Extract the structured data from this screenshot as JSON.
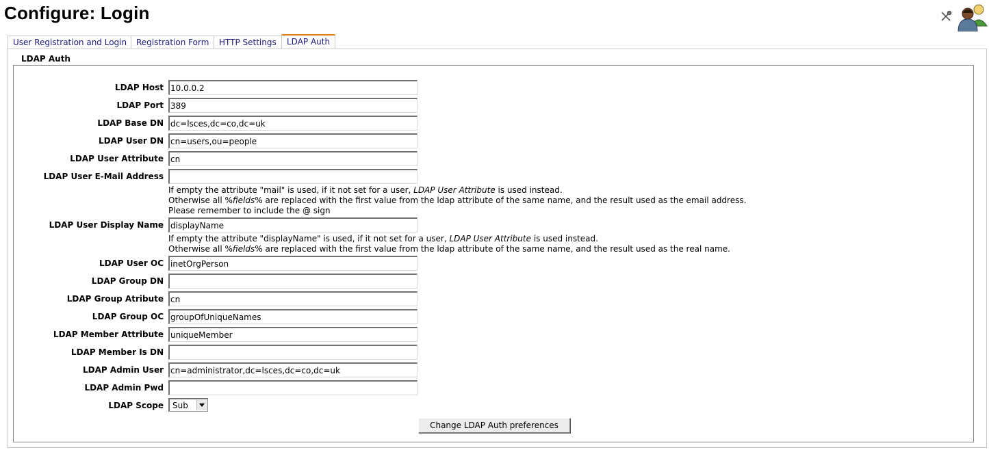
{
  "page": {
    "title": "Configure: Login"
  },
  "tabs": [
    {
      "label": "User Registration and Login"
    },
    {
      "label": "Registration Form"
    },
    {
      "label": "HTTP Settings"
    },
    {
      "label": "LDAP Auth"
    }
  ],
  "form": {
    "legend": "LDAP Auth",
    "fields": [
      {
        "label": "LDAP Host",
        "value": "10.0.0.2"
      },
      {
        "label": "LDAP Port",
        "value": "389"
      },
      {
        "label": "LDAP Base DN",
        "value": "dc=lsces,dc=co,dc=uk"
      },
      {
        "label": "LDAP User DN",
        "value": "cn=users,ou=people"
      },
      {
        "label": "LDAP User Attribute",
        "value": "cn"
      },
      {
        "label": "LDAP User E-Mail Address",
        "value": "",
        "help": [
          {
            "pre": "If empty the attribute \"mail\" is used, if it not set for a user, ",
            "em": "LDAP User Attribute",
            "post": " is used instead."
          },
          {
            "pre": "Otherwise all %",
            "em": "fields",
            "post": "% are replaced with the first value from the ldap attribute of the same name, and the result used as the email address."
          },
          {
            "pre": "Please remember to include the @ sign",
            "em": "",
            "post": ""
          }
        ]
      },
      {
        "label": "LDAP User Display Name",
        "value": "displayName",
        "help": [
          {
            "pre": "If empty the attribute \"displayName\" is used, if it not set for a user, ",
            "em": "LDAP User Attribute",
            "post": " is used instead."
          },
          {
            "pre": "Otherwise all %",
            "em": "fields",
            "post": "% are replaced with the first value from the ldap attribute of the same name, and the result used as the real name."
          }
        ]
      },
      {
        "label": "LDAP User OC",
        "value": "inetOrgPerson"
      },
      {
        "label": "LDAP Group DN",
        "value": ""
      },
      {
        "label": "LDAP Group Atribute",
        "value": "cn"
      },
      {
        "label": "LDAP Group OC",
        "value": "groupOfUniqueNames"
      },
      {
        "label": "LDAP Member Attribute",
        "value": "uniqueMember"
      },
      {
        "label": "LDAP Member Is DN",
        "value": ""
      },
      {
        "label": "LDAP Admin User",
        "value": "cn=administrator,dc=lsces,dc=co,dc=uk"
      },
      {
        "label": "LDAP Admin Pwd",
        "value": ""
      }
    ],
    "scope": {
      "label": "LDAP Scope",
      "value": "Sub"
    },
    "submit_label": "Change LDAP Auth preferences"
  },
  "icons": {
    "tools": "tools-icon",
    "users": "users-icon"
  }
}
